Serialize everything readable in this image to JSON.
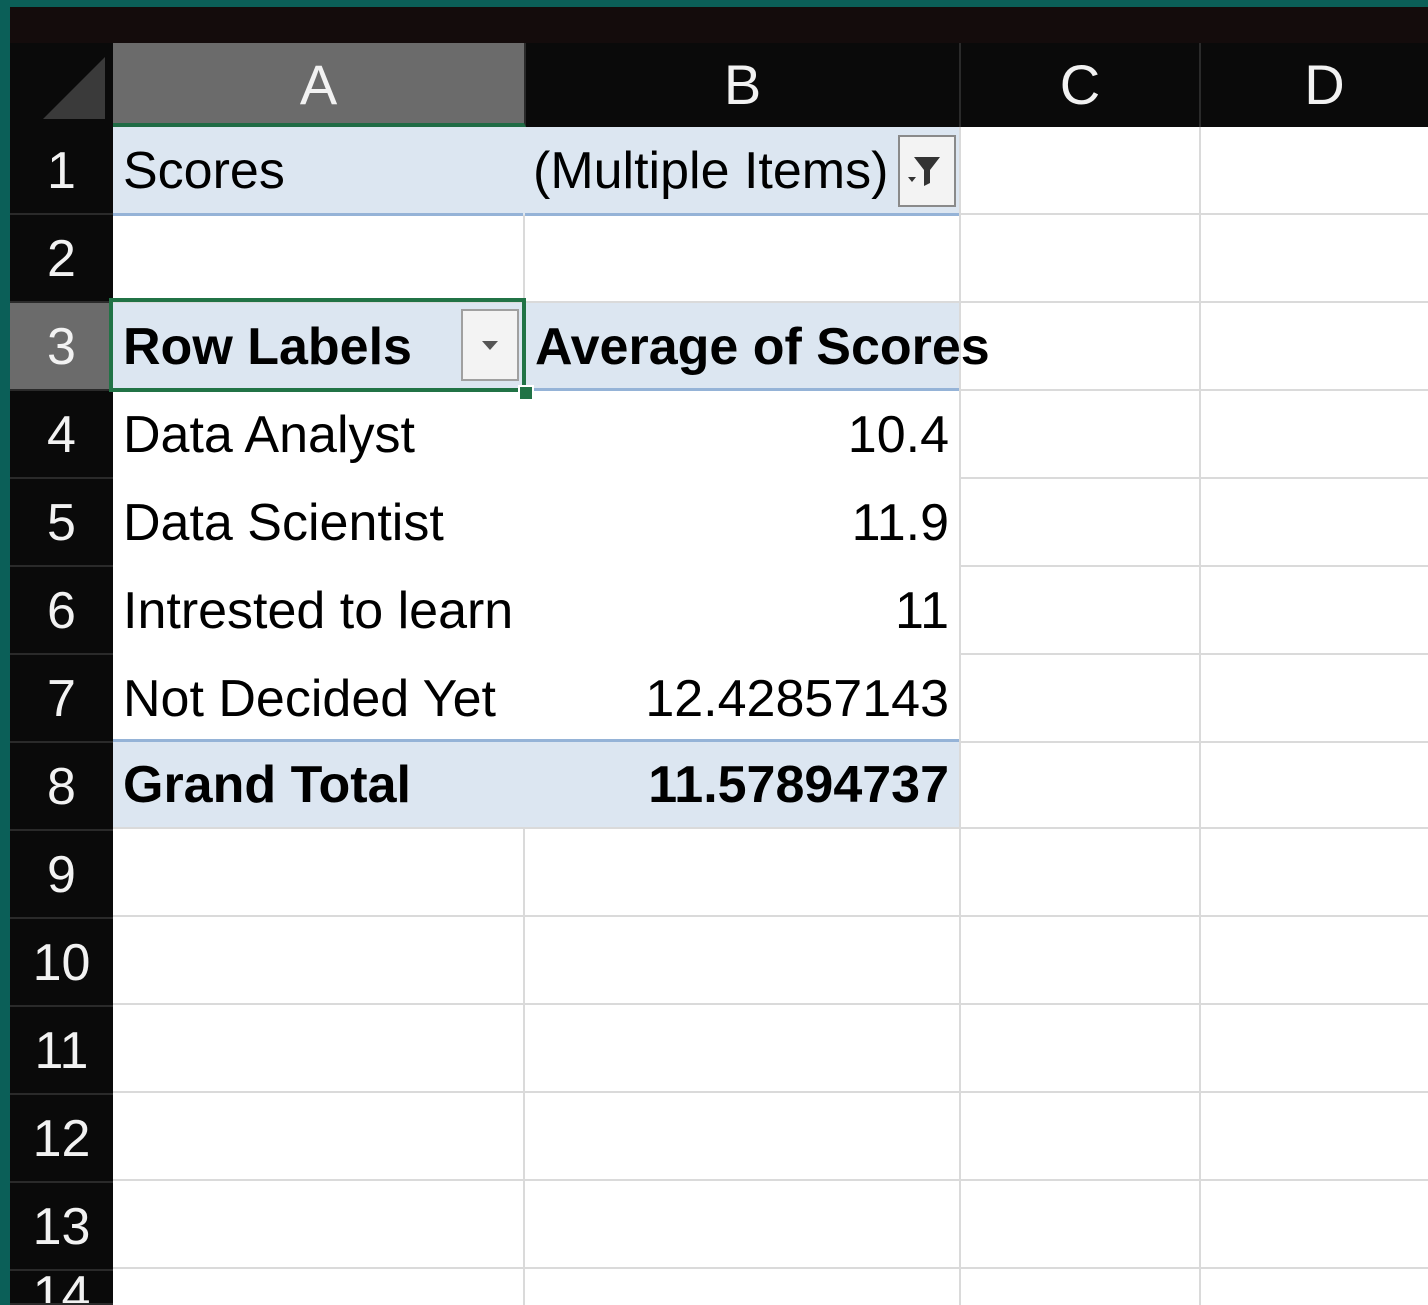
{
  "columns": [
    "A",
    "B",
    "C",
    "D"
  ],
  "rows": [
    "1",
    "2",
    "3",
    "4",
    "5",
    "6",
    "7",
    "8",
    "9",
    "10",
    "11",
    "12",
    "13",
    "14"
  ],
  "pivot": {
    "filter_label": "Scores",
    "filter_value": "(Multiple Items)",
    "header_row_label": "Row Labels",
    "header_value_label": "Average of Scores",
    "items": [
      {
        "label": "Data Analyst",
        "value": "10.4"
      },
      {
        "label": "Data Scientist",
        "value": "11.9"
      },
      {
        "label": "Intrested to learn",
        "value": "11"
      },
      {
        "label": "Not Decided Yet",
        "value": "12.42857143"
      }
    ],
    "grand_total_label": "Grand Total",
    "grand_total_value": "11.57894737"
  },
  "icons": {
    "filter": "filter-funnel-icon",
    "dropdown": "chevron-down-icon"
  },
  "colors": {
    "frame": "#0b5f58",
    "header_bg": "#0a0a0a",
    "pivot_band": "#dce6f1",
    "pivot_border": "#95b3d7",
    "active_cell": "#217346"
  }
}
